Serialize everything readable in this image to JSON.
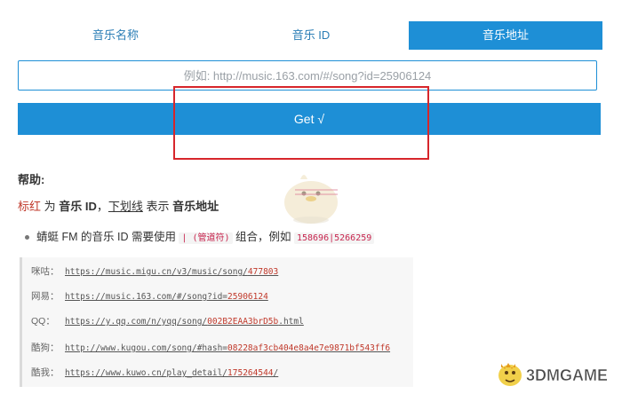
{
  "tabs": [
    {
      "label": "音乐名称"
    },
    {
      "label": "音乐 ID"
    },
    {
      "label": "音乐地址"
    }
  ],
  "search": {
    "placeholder": "例如: http://music.163.com/#/song?id=25906124"
  },
  "get_button": {
    "label": "Get √"
  },
  "help": {
    "title": "帮助:",
    "legend": {
      "red_word": "标红",
      "mid1": " 为 ",
      "id_word": "音乐 ID",
      "mid2": "，",
      "underline_word": "下划线",
      "mid3": " 表示 ",
      "url_word": "音乐地址"
    },
    "bullet": {
      "text1": "蜻蜓 FM 的音乐 ID 需要使用 ",
      "code1": "| (管道符)",
      "text2": " 组合，例如 ",
      "code2": "158696|5266259"
    }
  },
  "examples": [
    {
      "label": "咪咕：",
      "prefix": "https://music.migu.cn/v3/music/song/",
      "id": "477803"
    },
    {
      "label": "网易：",
      "prefix": "https://music.163.com/#/song?id=",
      "id": "25906124"
    },
    {
      "label": "QQ：",
      "prefix": "https://y.qq.com/n/yqq/song/",
      "id": "002B2EAA3brD5b",
      "suffix": ".html"
    },
    {
      "label": "酷狗：",
      "prefix": "http://www.kugou.com/song/#hash=",
      "id": "08228af3cb404e8a4e7e9871bf543ff6",
      "suffix": ""
    },
    {
      "label": "酷我：",
      "prefix": "https://www.kuwo.cn/play_detail/",
      "id": "175264544",
      "suffix": "/"
    }
  ],
  "watermark": {
    "text": "3DMGAME"
  },
  "colors": {
    "accent": "#1e8fd6",
    "highlight": "#d7262b",
    "id_red": "#c0392b"
  }
}
